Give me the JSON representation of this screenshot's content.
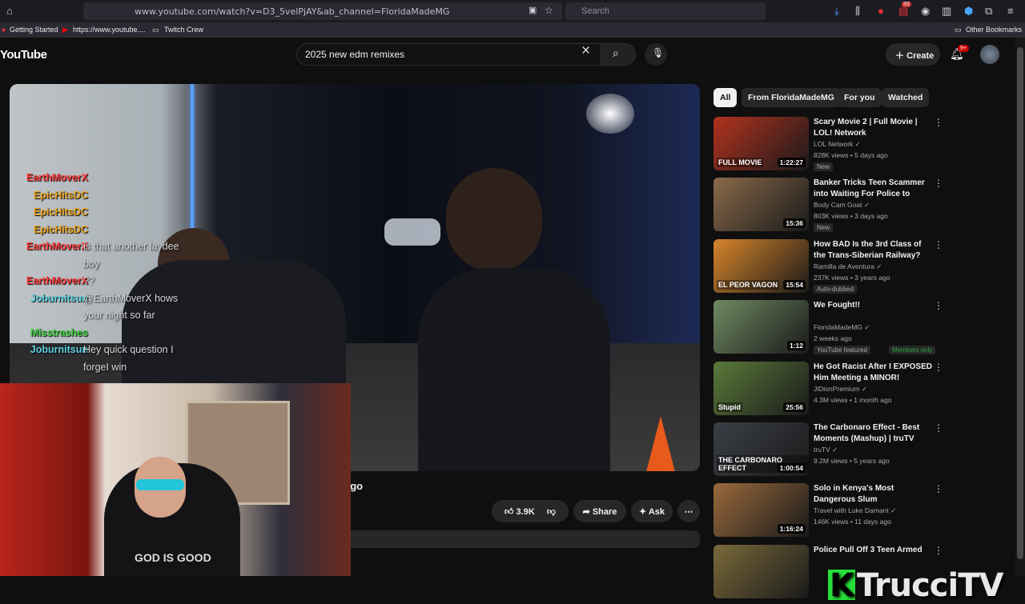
{
  "browser": {
    "url": "www.youtube.com/watch?v=D3_5velPjAY&ab_channel=FloridaMadeMG",
    "search_placeholder": "Search",
    "notif_count": "33",
    "bookmarks": [
      "Getting Started",
      "https://www.youtube....",
      "Twitch Crew"
    ],
    "other_bookmarks": "Other Bookmarks"
  },
  "youtube": {
    "logo": "YouTube",
    "search_query": "2025 new edm remixes",
    "create_label": "Create",
    "notif_badge": "9+"
  },
  "video": {
    "title_fragment": "ago",
    "likes": "3.9K",
    "share_label": "Share",
    "ask_label": "Ask"
  },
  "chat": [
    {
      "user": "EarthMoverX",
      "color": "#ff3b3b",
      "text": ""
    },
    {
      "user": "EpicHitsDC",
      "color": "#e8a21c",
      "text": ""
    },
    {
      "user": "EpicHitsDC",
      "color": "#e8a21c",
      "text": ""
    },
    {
      "user": "EpicHitsDC",
      "color": "#e8a21c",
      "text": ""
    },
    {
      "user": "EarthMoverX",
      "color": "#ff3b3b",
      "text": "is that another laydee"
    },
    {
      "user": "",
      "color": "#ff3b3b",
      "text": "boy"
    },
    {
      "user": "EarthMoverX",
      "color": "#ff3b3b",
      "text": "??"
    },
    {
      "user": "Joburnitsun",
      "color": "#5fd1e0",
      "text": "@EarthMoverX hows"
    },
    {
      "user": "",
      "color": "#5fd1e0",
      "text": "your night so far"
    },
    {
      "user": "Misstrashes",
      "color": "#3fd13f",
      "text": ""
    },
    {
      "user": "Joburnitsun",
      "color": "#5fd1e0",
      "text": "Hey quick question I"
    },
    {
      "user": "",
      "color": "#5fd1e0",
      "text": "forgeI win"
    }
  ],
  "webcam": {
    "shirt_text": "GOD IS GOOD"
  },
  "chips": [
    "All",
    "From FloridaMadeMG",
    "For you",
    "Watched"
  ],
  "recommendations": [
    {
      "title": "Scary Movie 2 | Full Movie | LOL! Network",
      "channel": "LOL Network",
      "views": "828K views • 5 days ago",
      "tags": [
        "New"
      ],
      "duration": "1:22:27",
      "thumb": "#b2321f",
      "thumb_text": "FULL MOVIE"
    },
    {
      "title": "Banker Tricks Teen Scammer into Waiting For Police to Arriv...",
      "channel": "Body Cam Goat",
      "views": "803K views • 3 days ago",
      "tags": [
        "New"
      ],
      "duration": "15:36",
      "thumb": "#8a6a4a",
      "thumb_text": ""
    },
    {
      "title": "How BAD Is the 3rd Class of the Trans-Siberian Railway?",
      "channel": "Ramilla de Aventura",
      "views": "237K views • 3 years ago",
      "tags": [
        "Auto-dubbed"
      ],
      "duration": "15:54",
      "thumb": "#d6852a",
      "thumb_text": "EL PEOR VAGON"
    },
    {
      "title": "We Fought!!",
      "channel": "FloridaMadeMG",
      "views": "2 weeks ago",
      "tags": [
        "YouTube featured",
        "Members only"
      ],
      "duration": "1:12",
      "thumb": "#6f8a62",
      "thumb_text": ""
    },
    {
      "title": "He Got Racist After I EXPOSED Him Meeting a MINOR!",
      "channel": "JiDionPremium",
      "views": "4.3M views • 1 month ago",
      "tags": [],
      "duration": "25:56",
      "thumb": "#5b7a3a",
      "thumb_text": "Stupid"
    },
    {
      "title": "The Carbonaro Effect - Best Moments (Mashup) | truTV",
      "channel": "truTV",
      "views": "9.2M views • 5 years ago",
      "tags": [],
      "duration": "1:00:54",
      "thumb": "#3b3f46",
      "thumb_text": "THE CARBONARO EFFECT"
    },
    {
      "title": "Solo in Kenya's Most Dangerous Slum",
      "channel": "Travel with Luke Damant",
      "views": "146K views • 11 days ago",
      "tags": [],
      "duration": "1:16:24",
      "thumb": "#9a6a3c",
      "thumb_text": ""
    },
    {
      "title": "Police Pull Off 3 Teen Armed",
      "channel": "",
      "views": "",
      "tags": [],
      "duration": "",
      "thumb": "#7a6a3a",
      "thumb_text": ""
    }
  ],
  "overlay_brand": "TrucciTV",
  "overlay_brand_mark": "K"
}
